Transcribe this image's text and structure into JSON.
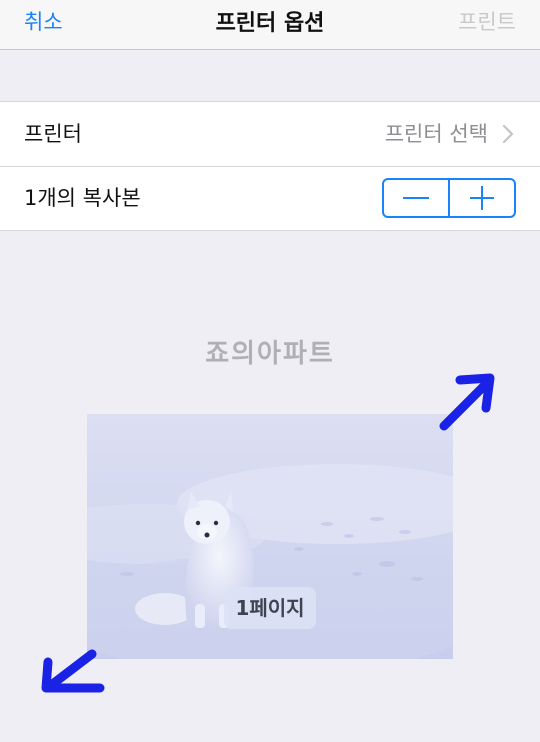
{
  "navbar": {
    "cancel_label": "취소",
    "title": "프린터 옵션",
    "print_label": "프린트"
  },
  "settings": {
    "printer_label": "프린터",
    "printer_value": "프린터 선택",
    "copies_label": "1개의 복사본",
    "decrement_icon": "minus-icon",
    "increment_icon": "plus-icon"
  },
  "preview": {
    "watermark": "죠의아파트",
    "page_label": "1페이지",
    "image_subject": "arctic fox sitting in snow"
  },
  "colors": {
    "accent": "#1a82fb",
    "disabled": "#c9c9cc",
    "background": "#efeef4",
    "annotation_arrow": "#1a22e6"
  }
}
